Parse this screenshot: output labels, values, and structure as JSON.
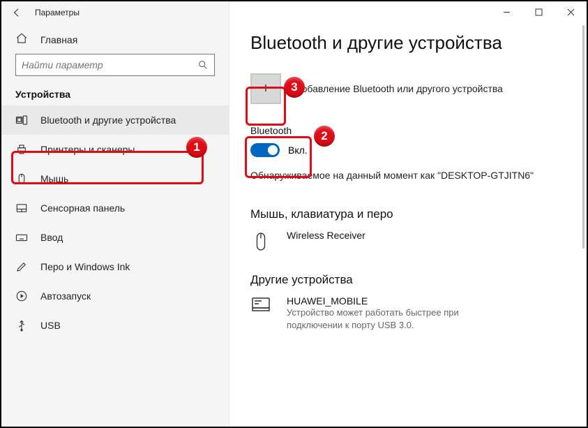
{
  "window": {
    "title": "Параметры"
  },
  "sidebar": {
    "home": "Главная",
    "search_placeholder": "Найти параметр",
    "section_title": "Устройства",
    "items": [
      {
        "label": "Bluetooth и другие устройства"
      },
      {
        "label": "Принтеры и сканеры"
      },
      {
        "label": "Мышь"
      },
      {
        "label": "Сенсорная панель"
      },
      {
        "label": "Ввод"
      },
      {
        "label": "Перо и Windows Ink"
      },
      {
        "label": "Автозапуск"
      },
      {
        "label": "USB"
      }
    ]
  },
  "page": {
    "heading": "Bluetooth и другие устройства",
    "add_label": "Добавление Bluetooth или другого устройства",
    "bluetooth_title": "Bluetooth",
    "bluetooth_state": "Вкл.",
    "discoverable": "Обнаруживаемое на данный момент как \"DESKTOP-GTJITN6\"",
    "section_mouse": "Мышь, клавиатура и перо",
    "mouse_device": {
      "name": "Wireless Receiver"
    },
    "section_other": "Другие устройства",
    "other_device": {
      "name": "HUAWEI_MOBILE",
      "desc": "Устройство может работать быстрее при подключении к порту USB 3.0."
    }
  },
  "annotations": {
    "1": "1",
    "2": "2",
    "3": "3"
  }
}
